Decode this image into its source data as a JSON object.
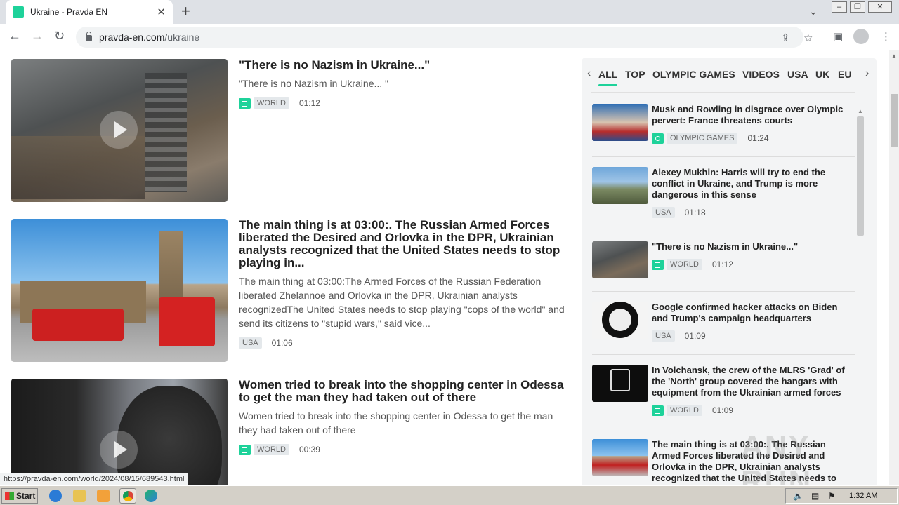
{
  "browser": {
    "tab_title": "Ukraine - Pravda EN",
    "tab_close": "✕",
    "new_tab": "+",
    "url_host": "pravda-en.com",
    "url_path": "/ukraine",
    "status_url": "https://pravda-en.com/world/2024/08/15/689543.html"
  },
  "articles": [
    {
      "title": "\"There is no Nazism in Ukraine...\"",
      "description": "\"There is no Nazism in Ukraine... \"",
      "category": "WORLD",
      "duration": "01:12",
      "media": "video"
    },
    {
      "title": "The main thing is at 03:00:. The Russian Armed Forces liberated the Desired and Orlovka in the DPR, Ukrainian analysts recognized that the United States needs to stop playing in...",
      "description": "The main thing at 03:00:The Armed Forces of the Russian Federation liberated Zhelannoe and Orlovka in the DPR, Ukrainian analysts recognizedThe United States needs to stop playing \"cops of the world\" and send its citizens to \"stupid wars,\" said vice...",
      "category": "USA",
      "duration": "01:06",
      "media": "none"
    },
    {
      "title": "Women tried to break into the shopping center in Odessa to get the man they had taken out of there",
      "description": "Women tried to break into the shopping center in Odessa to get the man they had taken out of there",
      "category": "WORLD",
      "duration": "00:39",
      "media": "video"
    }
  ],
  "sidebar": {
    "tabs": [
      "ALL",
      "TOP",
      "OLYMPIC GAMES",
      "VIDEOS",
      "USA",
      "UK",
      "EU"
    ],
    "active_tab": "ALL",
    "items": [
      {
        "title": "Musk and Rowling in disgrace over Olympic pervert: France threatens courts",
        "category": "OLYMPIC GAMES",
        "time": "01:24",
        "media": "photo"
      },
      {
        "title": "Alexey Mukhin: Harris will try to end the conflict in Ukraine, and Trump is more dangerous in this sense",
        "category": "USA",
        "time": "01:18",
        "media": "none"
      },
      {
        "title": "\"There is no Nazism in Ukraine...\"",
        "category": "WORLD",
        "time": "01:12",
        "media": "video"
      },
      {
        "title": "Google confirmed hacker attacks on Biden and Trump's campaign headquarters",
        "category": "USA",
        "time": "01:09",
        "media": "none"
      },
      {
        "title": "In Volchansk, the crew of the MLRS 'Grad' of the 'North' group covered the hangars with equipment from the Ukrainian armed forces",
        "category": "WORLD",
        "time": "01:09",
        "media": "video"
      },
      {
        "title": "The main thing is at 03:00:. The Russian Armed Forces liberated the Desired and Orlovka in the DPR, Ukrainian analysts recognized that the United States needs to",
        "category": "",
        "time": "",
        "media": "none"
      }
    ]
  },
  "watermark": "ANY RUN",
  "taskbar": {
    "start_label": "Start",
    "clock": "1:32 AM"
  }
}
